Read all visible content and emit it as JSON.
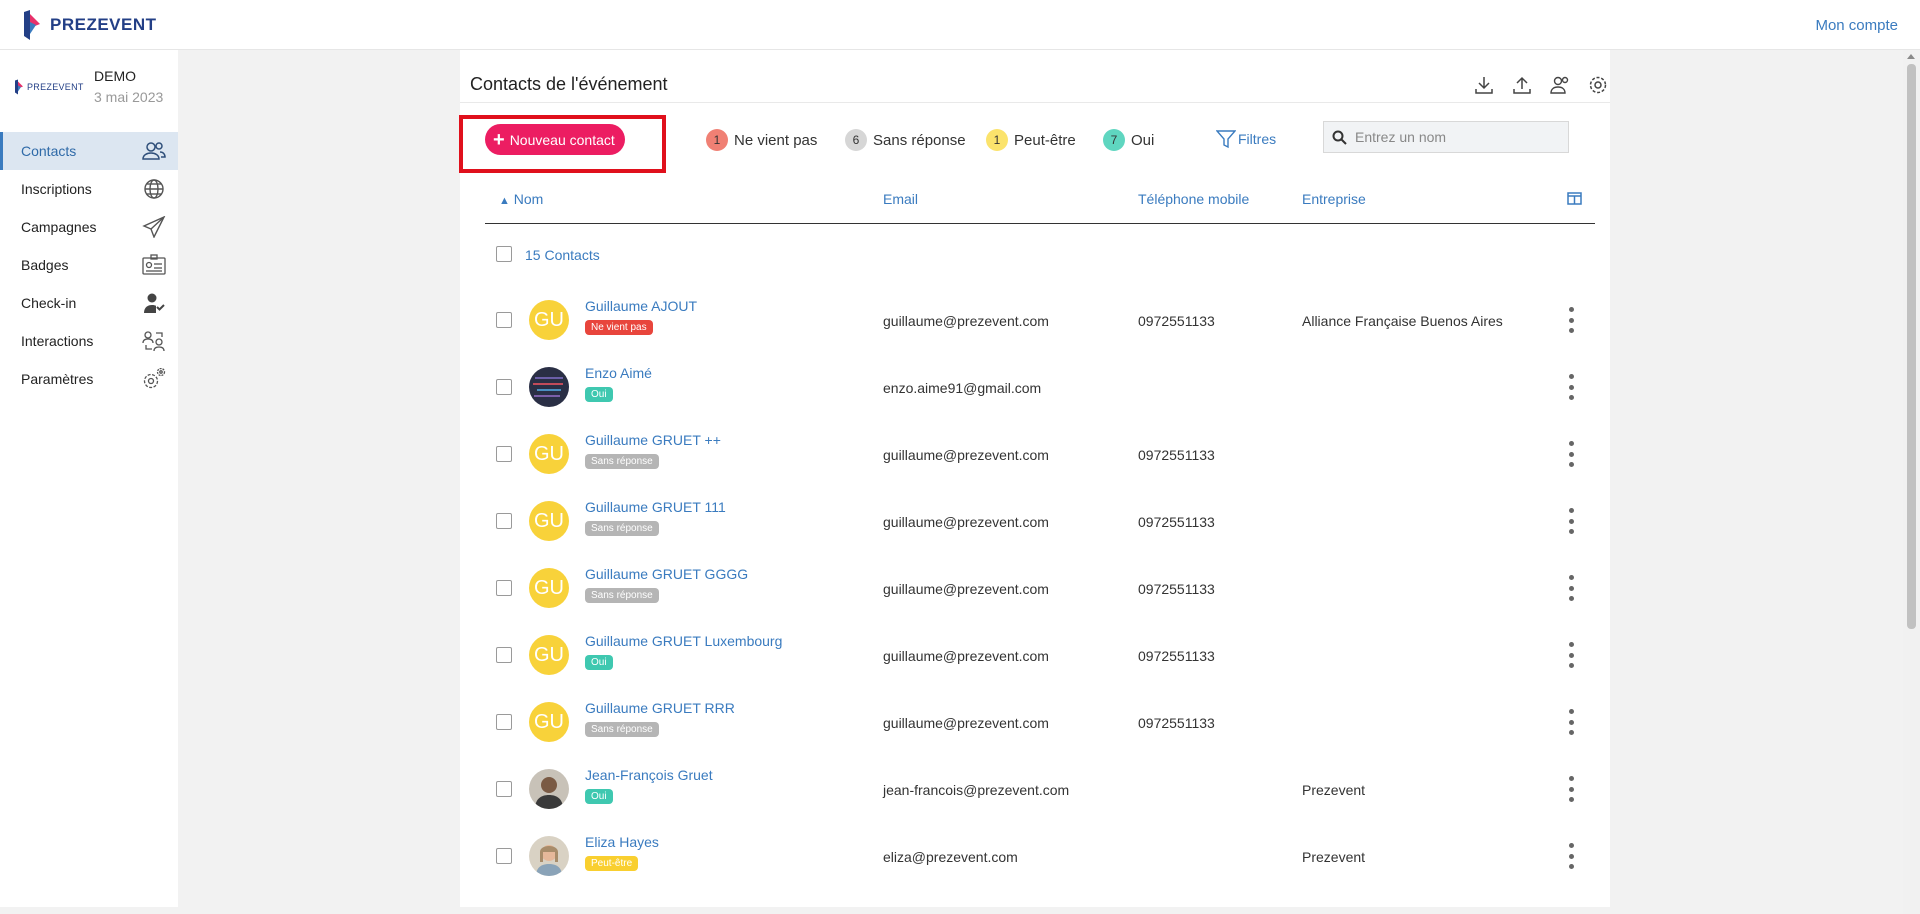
{
  "app": {
    "brand": "PREZEVENT",
    "account_link": "Mon compte"
  },
  "event": {
    "logo_text": "PREZEVENT",
    "name": "DEMO",
    "date": "3 mai 2023"
  },
  "sidebar": {
    "items": [
      {
        "label": "Contacts",
        "icon": "contacts-icon",
        "active": true
      },
      {
        "label": "Inscriptions",
        "icon": "globe-icon"
      },
      {
        "label": "Campagnes",
        "icon": "paper-plane-icon"
      },
      {
        "label": "Badges",
        "icon": "badge-icon"
      },
      {
        "label": "Check-in",
        "icon": "check-in-user-icon"
      },
      {
        "label": "Interactions",
        "icon": "interactions-icon"
      },
      {
        "label": "Paramètres",
        "icon": "settings-gears-icon"
      }
    ]
  },
  "page": {
    "title": "Contacts de l'événement",
    "header_icons": [
      "download-icon",
      "upload-icon",
      "users-icon",
      "gear-icon"
    ]
  },
  "toolbar": {
    "new_contact_label": "Nouveau contact",
    "status_chips": [
      {
        "count": "1",
        "label": "Ne vient pas",
        "color": "#f08074"
      },
      {
        "count": "6",
        "label": "Sans réponse",
        "color": "#d6d6d6"
      },
      {
        "count": "1",
        "label": "Peut-être",
        "color": "#fbe36c"
      },
      {
        "count": "7",
        "label": "Oui",
        "color": "#5fd6c0"
      }
    ],
    "filters_label": "Filtres",
    "search_placeholder": "Entrez un nom"
  },
  "table": {
    "columns": {
      "name": "Nom",
      "email": "Email",
      "phone": "Téléphone mobile",
      "company": "Entreprise"
    },
    "count_label": "15 Contacts",
    "rows": [
      {
        "initials": "GU",
        "name": "Guillaume AJOUT",
        "status": "Ne vient pas",
        "status_color": "#e8453c",
        "email": "guillaume@prezevent.com",
        "phone": "0972551133",
        "company": "Alliance Française Buenos Aires"
      },
      {
        "initials": "",
        "photo": "dark-avatar",
        "name": "Enzo Aimé",
        "status": "Oui",
        "status_color": "#3fc8b0",
        "email": "enzo.aime91@gmail.com",
        "phone": "",
        "company": ""
      },
      {
        "initials": "GU",
        "name": "Guillaume GRUET ++",
        "status": "Sans réponse",
        "status_color": "#b5b5b5",
        "email": "guillaume@prezevent.com",
        "phone": "0972551133",
        "company": ""
      },
      {
        "initials": "GU",
        "name": "Guillaume GRUET 111",
        "status": "Sans réponse",
        "status_color": "#b5b5b5",
        "email": "guillaume@prezevent.com",
        "phone": "0972551133",
        "company": ""
      },
      {
        "initials": "GU",
        "name": "Guillaume GRUET GGGG",
        "status": "Sans réponse",
        "status_color": "#b5b5b5",
        "email": "guillaume@prezevent.com",
        "phone": "0972551133",
        "company": ""
      },
      {
        "initials": "GU",
        "name": "Guillaume GRUET Luxembourg",
        "status": "Oui",
        "status_color": "#3fc8b0",
        "email": "guillaume@prezevent.com",
        "phone": "0972551133",
        "company": ""
      },
      {
        "initials": "GU",
        "name": "Guillaume GRUET RRR",
        "status": "Sans réponse",
        "status_color": "#b5b5b5",
        "email": "guillaume@prezevent.com",
        "phone": "0972551133",
        "company": ""
      },
      {
        "initials": "",
        "photo": "man-avatar",
        "name": "Jean-François Gruet",
        "status": "Oui",
        "status_color": "#3fc8b0",
        "email": "jean-francois@prezevent.com",
        "phone": "",
        "company": "Prezevent"
      },
      {
        "initials": "",
        "photo": "woman-avatar",
        "name": "Eliza Hayes",
        "status": "Peut-être",
        "status_color": "#f9cf2f",
        "email": "eliza@prezevent.com",
        "phone": "",
        "company": "Prezevent"
      }
    ]
  }
}
